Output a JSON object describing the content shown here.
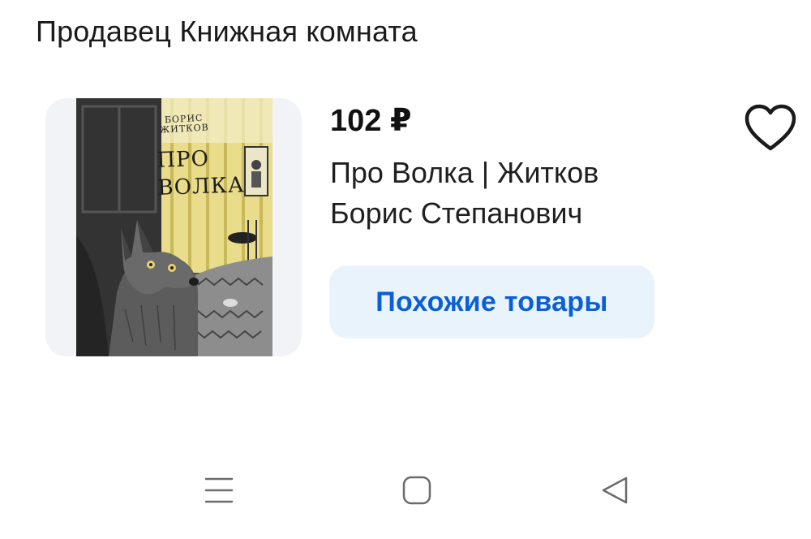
{
  "seller": {
    "title": "Продавец Книжная комната"
  },
  "product": {
    "price": "102 ₽",
    "name": "Про Волка | Житков Борис Степанович",
    "cover": {
      "author_text": "БОРИС ЖИТКОВ",
      "title_line1": "ПРО",
      "title_line2": "ВОЛКА"
    },
    "similar_label": "Похожие товары",
    "favorite_icon": "heart-outline-icon"
  },
  "colors": {
    "accent": "#0a5fd8",
    "accent_bg": "#e9f3fc",
    "image_bg": "#f2f3f7"
  },
  "system_nav": {
    "items": [
      {
        "icon": "menu-lines-icon"
      },
      {
        "icon": "home-square-icon"
      },
      {
        "icon": "back-triangle-icon"
      }
    ]
  }
}
